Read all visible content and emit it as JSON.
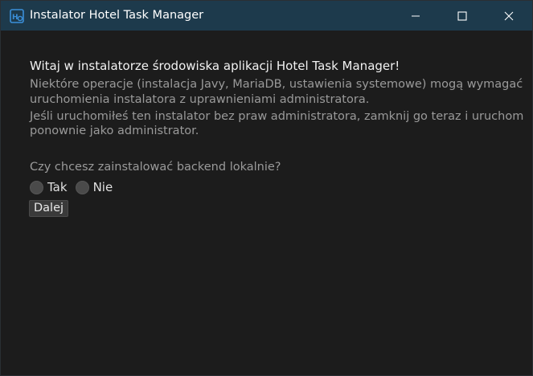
{
  "window": {
    "title": "Instalator Hotel Task Manager",
    "controls": {
      "minimize": "minimize-icon",
      "maximize": "maximize-icon",
      "close": "close-icon"
    }
  },
  "content": {
    "intro": "Witaj w instalatorze środowiska aplikacji Hotel Task Manager!",
    "note_lines": [
      "Niektóre operacje (instalacja Javy, MariaDB, ustawienia systemowe) mogą wymagać",
      "uruchomienia instalatora z uprawnieniami administratora.",
      "Jeśli uruchomiłeś ten instalator bez praw administratora, zamknij go teraz i uruchom",
      "ponownie jako administrator."
    ],
    "question": "Czy chcesz zainstalować backend lokalnie?",
    "options": [
      {
        "label": "Tak",
        "selected": false
      },
      {
        "label": "Nie",
        "selected": false
      }
    ],
    "next_button": "Dalej"
  },
  "colors": {
    "titlebar": "#1d3a4c",
    "background": "#1c1c1c",
    "primary_text": "#f2f2f2",
    "secondary_text": "#9a9a9a",
    "app_icon": "#3b8fd9"
  }
}
